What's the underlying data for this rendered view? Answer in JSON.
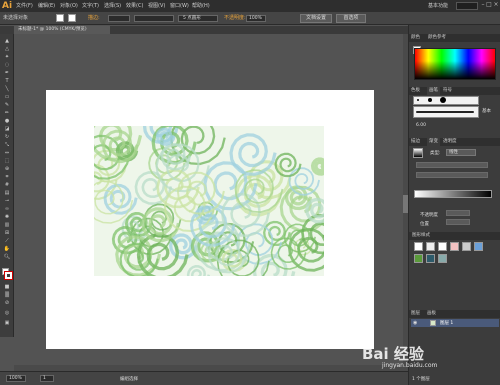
{
  "app": {
    "logo": "Ai",
    "workspace": "基本功能"
  },
  "menu": [
    "文件(F)",
    "编辑(E)",
    "对象(O)",
    "文字(T)",
    "选择(S)",
    "效果(C)",
    "视图(V)",
    "窗口(W)",
    "帮助(H)"
  ],
  "control": {
    "selection": "未选择对象",
    "stroke_label": "描边:",
    "brush": "5 点圆形",
    "opacity_label": "不透明度:",
    "opacity": "100%",
    "doc_setup": "文档设置",
    "prefs": "首选项"
  },
  "doc_tab": "未标题-1* @ 100% (CMYK/预览)",
  "status": {
    "zoom": "100%",
    "page": "1",
    "tool": "编组选择"
  },
  "panels": {
    "color_tabs": [
      "颜色",
      "颜色参考"
    ],
    "brush_tabs": [
      "色板",
      "画笔",
      "符号"
    ],
    "brush_label": "基本",
    "stroke_size": "6.00",
    "gradient_tabs": [
      "描边",
      "渐变",
      "透明度"
    ],
    "gradient_type_label": "类型:",
    "gradient_type": "线性",
    "opacity_label": "不透明度",
    "position_label": "位置",
    "graphic_styles_title": "图形样式",
    "layer_name": "图层 1",
    "layers_tabs": [
      "图层",
      "画板"
    ],
    "layer_count": "1 个图层"
  },
  "watermark": {
    "brand": "Bai 经验",
    "url": "jingyan.baidu.com"
  }
}
